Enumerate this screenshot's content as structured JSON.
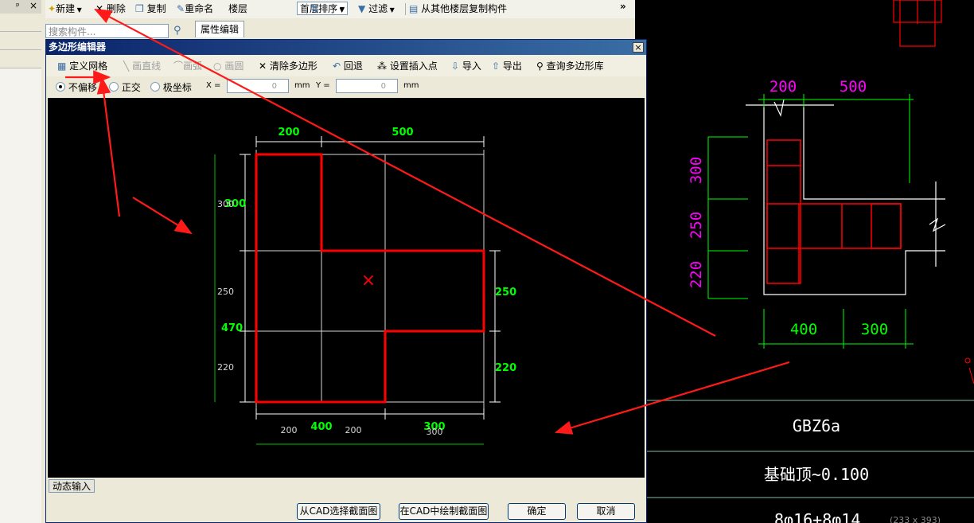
{
  "left_panel": {
    "pin_icon": "pin-icon",
    "close_glyph": "×"
  },
  "toolbar": {
    "new_label": "新建",
    "delete_label": "删除",
    "copy_label": "复制",
    "rename_label": "重命名",
    "floor_label": "楼层",
    "floor_value": "首层",
    "sort_label": "排序",
    "filter_label": "过滤",
    "copy_from_floor_label": "从其他楼层复制构件",
    "more_glyph": "»"
  },
  "search": {
    "placeholder": "搜索构件..."
  },
  "prop_tab": {
    "label": "属性编辑"
  },
  "dialog": {
    "title": "多边形编辑器",
    "close_glyph": "×",
    "tools": {
      "define_grid": "定义网格",
      "draw_line": "画直线",
      "draw_arc": "画弧",
      "draw_circle": "画圆",
      "clear_polygon": "清除多边形",
      "undo": "回退",
      "set_insert_point": "设置插入点",
      "import": "导入",
      "export": "导出",
      "query_library": "查询多边形库"
    },
    "options": {
      "no_offset": "不偏移",
      "orthogonal": "正交",
      "polar": "极坐标",
      "x_label": "X =",
      "x_value": "0",
      "x_unit": "mm",
      "y_label": "Y =",
      "y_value": "0",
      "y_unit": "mm"
    },
    "drawing": {
      "top_dims": [
        "200",
        "500"
      ],
      "left_labels": [
        "300",
        "250",
        "220"
      ],
      "left_overlay_labels": [
        "300",
        "470"
      ],
      "right_dims": [
        "250",
        "220"
      ],
      "bottom_small": [
        "200",
        "200",
        "300"
      ],
      "bottom_big": [
        "400",
        "300"
      ],
      "insert_mark": "×"
    },
    "dynamic_input": "动态输入",
    "buttons": {
      "select_from_cad": "从CAD选择截面图",
      "draw_in_cad": "在CAD中绘制截面图",
      "ok": "确定",
      "cancel": "取消"
    }
  },
  "cad": {
    "top_dims": [
      "200",
      "500"
    ],
    "left_dims": [
      "300",
      "250",
      "220"
    ],
    "bottom_dims": [
      "400",
      "300"
    ],
    "table_rows": [
      "GBZ6a",
      "基础顶~0.100",
      "8φ16+8φ14"
    ],
    "size_hint": "(233 x 393)"
  },
  "colors": {
    "accent_red": "#ff0000",
    "dim_green": "#00ff00",
    "cad_magenta": "#ff00ff"
  }
}
